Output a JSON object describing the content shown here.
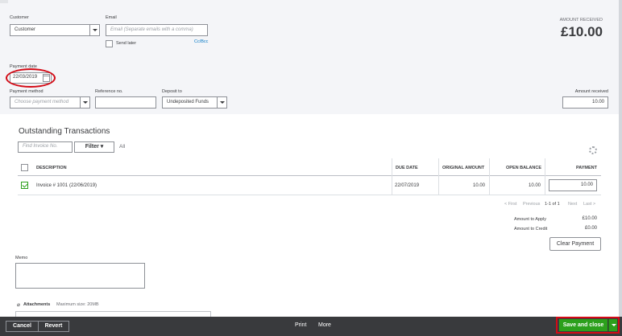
{
  "header": {
    "customer_label": "Customer",
    "customer_value": "Customer",
    "email_label": "Email",
    "email_placeholder": "Email (Separate emails with a comma)",
    "send_later_label": "Send later",
    "cc_bcc_link": "Cc/Bcc",
    "amount_received_label": "AMOUNT RECEIVED",
    "amount_received_value": "£10.00"
  },
  "payment": {
    "date_label": "Payment date",
    "date_value": "22/03/2019",
    "method_label": "Payment method",
    "method_placeholder": "Choose payment method",
    "reference_label": "Reference no.",
    "reference_value": "",
    "deposit_label": "Deposit to",
    "deposit_value": "Undeposited Funds",
    "amount_label": "Amount received",
    "amount_value": "10.00"
  },
  "outstanding": {
    "title": "Outstanding Transactions",
    "find_placeholder": "Find Invoice No.",
    "filter_label": "Filter ▾",
    "all_label": "All",
    "columns": [
      "DESCRIPTION",
      "DUE DATE",
      "ORIGINAL AMOUNT",
      "OPEN BALANCE",
      "PAYMENT"
    ],
    "rows": [
      {
        "invoice_link": "Invoice # 1001",
        "invoice_date": "(22/06/2019)",
        "due_date": "22/07/2019",
        "original_amount": "10.00",
        "open_balance": "10.00",
        "payment": "10.00",
        "checked": true
      }
    ],
    "pagination": {
      "first": "< First",
      "previous": "Previous",
      "range": "1-1 of 1",
      "next": "Next",
      "last": "Last >"
    }
  },
  "summary": {
    "amount_to_apply_label": "Amount to Apply",
    "amount_to_apply_value": "£10.00",
    "amount_to_credit_label": "Amount to Credit",
    "amount_to_credit_value": "£0.00",
    "clear_payment_label": "Clear Payment"
  },
  "memo": {
    "label": "Memo",
    "value": ""
  },
  "attachments": {
    "label": "Attachments",
    "max_size": "Maximum size: 20MB"
  },
  "footer": {
    "cancel": "Cancel",
    "revert": "Revert",
    "print": "Print",
    "more": "More",
    "save_and_close": "Save and close"
  },
  "colors": {
    "accent_green": "#2ca01c",
    "link_blue": "#0077c5",
    "highlight_red": "#d40b16",
    "footer_dark": "#393a3d"
  }
}
